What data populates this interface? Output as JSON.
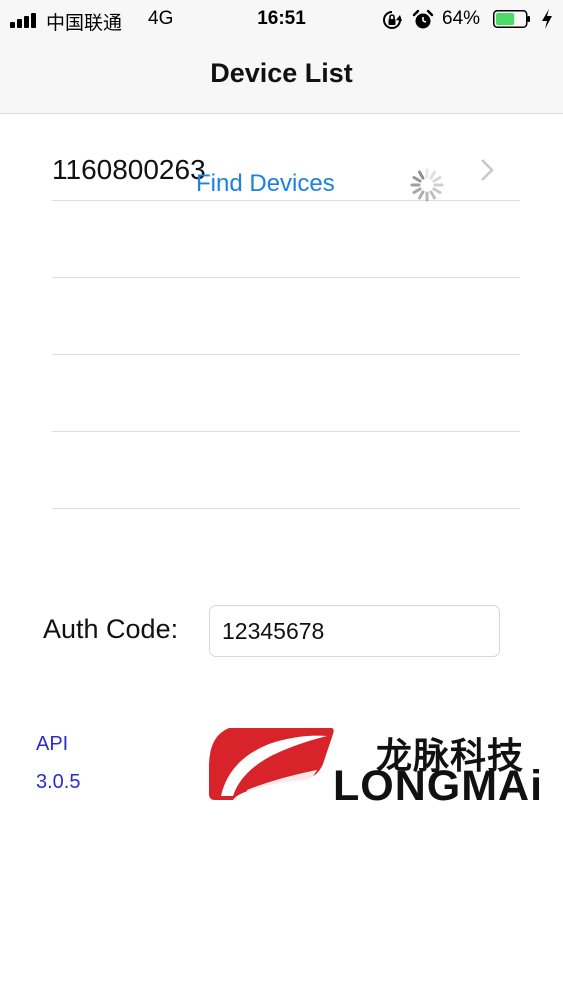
{
  "status_bar": {
    "carrier": "中国联通",
    "network": "4G",
    "time": "16:51",
    "battery_percent": "64%",
    "battery_level": 0.64,
    "battery_color": "#4cd964"
  },
  "nav": {
    "title": "Device List"
  },
  "device_list": {
    "rows": [
      {
        "label": "1160800263"
      },
      {
        "label": ""
      },
      {
        "label": ""
      },
      {
        "label": ""
      },
      {
        "label": ""
      }
    ],
    "overlay_text": "Find Devices"
  },
  "auth": {
    "label": "Auth Code:",
    "value": "12345678"
  },
  "footer": {
    "api_label": "API",
    "api_version": "3.0.5",
    "logo_cn": "龙脉科技",
    "logo_en": "LONGMAi",
    "logo_color": "#d9232a"
  },
  "colors": {
    "accent_blue": "#1a82e2",
    "api_blue": "#2b2bd1"
  },
  "icons": [
    "signal-icon",
    "orientation-lock-icon",
    "alarm-icon",
    "battery-icon",
    "charging-icon",
    "chevron-right-icon",
    "loading-spinner-icon",
    "longmai-logo-mark"
  ]
}
